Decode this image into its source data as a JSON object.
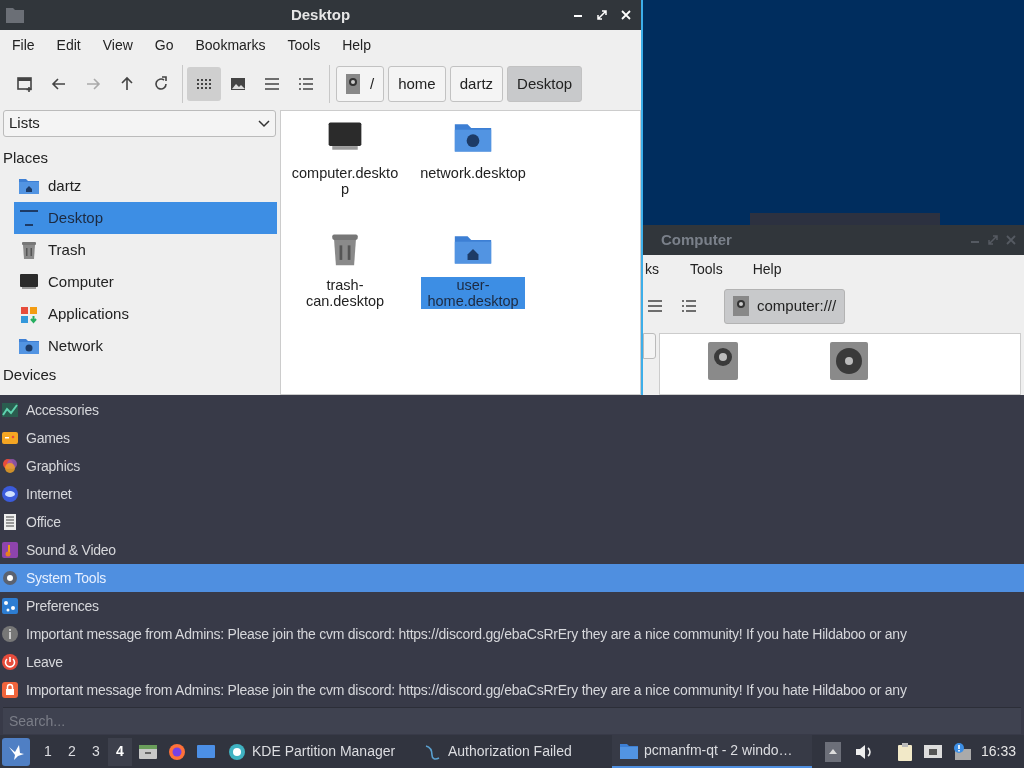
{
  "window": {
    "title": "Desktop",
    "menu": [
      "File",
      "Edit",
      "View",
      "Go",
      "Bookmarks",
      "Tools",
      "Help"
    ],
    "view_modes": [
      {
        "kind": "icons",
        "selected": true
      },
      {
        "kind": "thumbnails",
        "selected": false
      },
      {
        "kind": "compact",
        "selected": false
      },
      {
        "kind": "details",
        "selected": false
      }
    ],
    "path": [
      {
        "label": "/",
        "kind": "root",
        "selected": false
      },
      {
        "label": "home",
        "kind": "dir",
        "selected": false
      },
      {
        "label": "dartz",
        "kind": "dir",
        "selected": false
      },
      {
        "label": "Desktop",
        "kind": "dir",
        "selected": true
      }
    ],
    "sidebar": {
      "dropdown": "Lists",
      "sections": [
        {
          "title": "Places",
          "items": [
            {
              "label": "dartz",
              "kind": "home",
              "selected": false
            },
            {
              "label": "Desktop",
              "kind": "desktop",
              "selected": true
            },
            {
              "label": "Trash",
              "kind": "trash",
              "selected": false
            },
            {
              "label": "Computer",
              "kind": "computer",
              "selected": false
            },
            {
              "label": "Applications",
              "kind": "apps",
              "selected": false
            },
            {
              "label": "Network",
              "kind": "network",
              "selected": false
            }
          ]
        },
        {
          "title": "Devices"
        }
      ]
    },
    "files": [
      {
        "name": "computer.desktop",
        "kind": "computer",
        "selected": false
      },
      {
        "name": "network.desktop",
        "kind": "network",
        "selected": false
      },
      {
        "name": "trash-can.desktop",
        "kind": "trash",
        "selected": false
      },
      {
        "name": "user-home.desktop",
        "kind": "home",
        "selected": true
      }
    ]
  },
  "second_window": {
    "title": "Computer",
    "menu": [
      "ks",
      "Tools",
      "Help"
    ],
    "path": "computer:///",
    "devices": [
      {
        "kind": "drive"
      },
      {
        "kind": "optical"
      }
    ]
  },
  "app_menu": {
    "items": [
      {
        "label": "Accessories",
        "kind": "accessories",
        "selected": false
      },
      {
        "label": "Games",
        "kind": "games",
        "selected": false
      },
      {
        "label": "Graphics",
        "kind": "graphics",
        "selected": false
      },
      {
        "label": "Internet",
        "kind": "internet",
        "selected": false
      },
      {
        "label": "Office",
        "kind": "office",
        "selected": false
      },
      {
        "label": "Sound & Video",
        "kind": "media",
        "selected": false
      },
      {
        "label": "System Tools",
        "kind": "system",
        "selected": true
      },
      {
        "label": "Preferences",
        "kind": "preferences",
        "selected": false
      },
      {
        "label": "Important message from Admins: Please join the cvm discord: https://discord.gg/ebaCsRrEry they are a nice community! If you hate Hildaboo or any",
        "kind": "info",
        "selected": false
      },
      {
        "label": "Leave",
        "kind": "leave",
        "selected": false
      },
      {
        "label": "Important message from Admins: Please join the cvm discord: https://discord.gg/ebaCsRrEry they are a nice community! If you hate Hildaboo or any",
        "kind": "lock",
        "selected": false
      }
    ],
    "search": {
      "placeholder": "Search..."
    }
  },
  "taskbar": {
    "desktops": [
      {
        "label": "1",
        "selected": false
      },
      {
        "label": "2",
        "selected": false
      },
      {
        "label": "3",
        "selected": false
      },
      {
        "label": "4",
        "selected": true
      }
    ],
    "launchers": [
      {
        "kind": "files"
      },
      {
        "kind": "browser"
      },
      {
        "kind": "desktop"
      }
    ],
    "tasks": [
      {
        "label": "KDE Partition Manager",
        "kind": "partition",
        "selected": false
      },
      {
        "label": "Authorization Failed",
        "kind": "auth",
        "selected": false
      },
      {
        "label": "pcmanfm-qt - 2 windo…",
        "kind": "folder",
        "selected": true
      }
    ],
    "clock": "16:33"
  }
}
